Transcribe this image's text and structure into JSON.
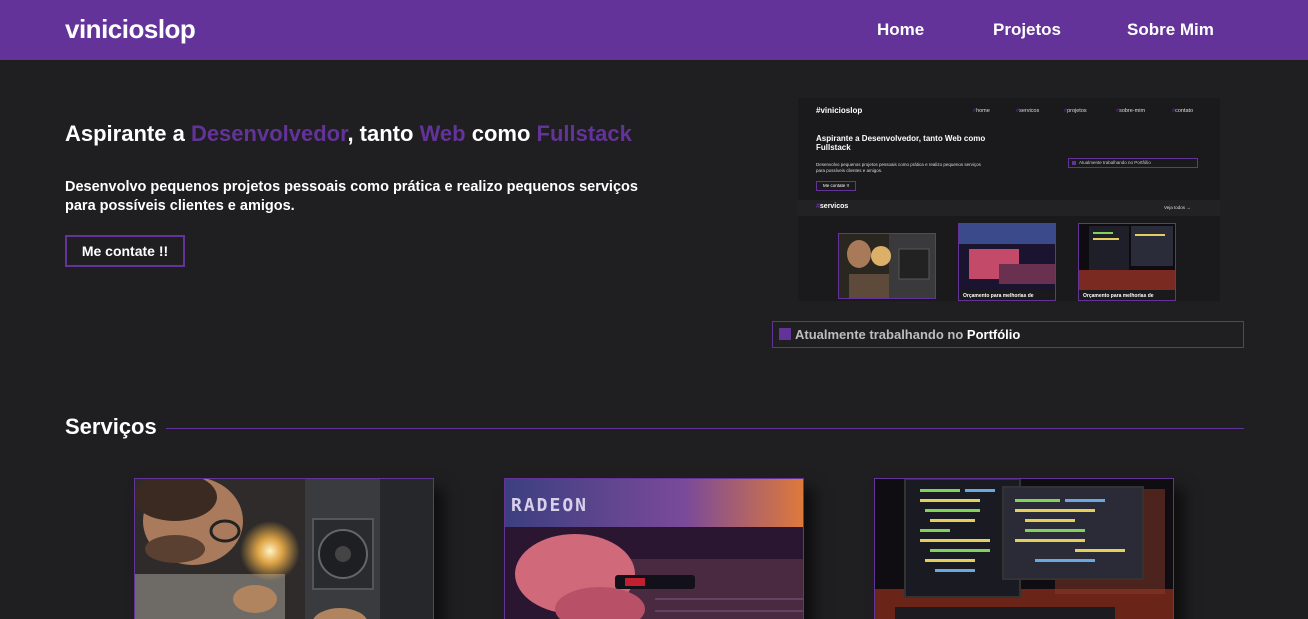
{
  "header": {
    "brand": "vinicioslop",
    "nav": [
      {
        "label": "Home"
      },
      {
        "label": "Projetos"
      },
      {
        "label": "Sobre Mim"
      }
    ]
  },
  "hero": {
    "title_parts": [
      "Aspirante a ",
      "Desenvolvedor",
      ", tanto ",
      "Web",
      " como ",
      "Fullstack"
    ],
    "description": "Desenvolvo pequenos projetos pessoais como prática e realizo pequenos serviços para possíveis clientes e amigos.",
    "cta_label": "Me contate !!"
  },
  "preview": {
    "brand": "#vinicioslop",
    "nav": [
      "home",
      "servicos",
      "projetos",
      "sobre-mim",
      "contato"
    ],
    "title": "Aspirante a Desenvolvedor, tanto Web como Fullstack",
    "description": "Desenvolvo pequenos projetos pessoais como prática e realizo pequenos serviços para possíveis clientes e amigos.",
    "cta_label": "Me contate !!",
    "status": "Atualmente trabalhando no Portfólio",
    "section": "servicos",
    "see_all": "Veja todos →",
    "card_captions": [
      "Orçamento para melhorias de",
      "Orçamento para melhorias de"
    ]
  },
  "status": {
    "prefix": "Atualmente trabalhando no ",
    "highlight": "Portfólio"
  },
  "services": {
    "title": "Serviços",
    "cards": [
      {
        "image": "technician-repairing-pc-photo"
      },
      {
        "image": "radeon-gpu-ssd-photo"
      },
      {
        "image": "code-on-monitors-photo"
      }
    ]
  },
  "colors": {
    "accent": "#633399",
    "background": "#1f1e20",
    "text": "#ffffff"
  }
}
